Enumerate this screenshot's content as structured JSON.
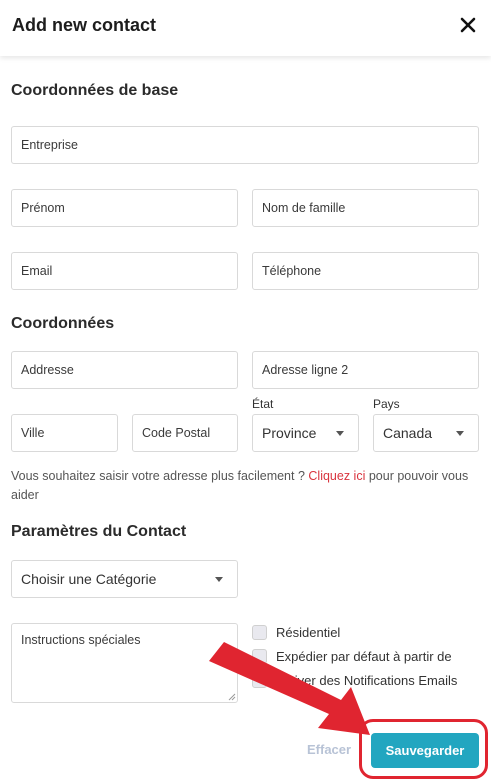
{
  "header": {
    "title": "Add new contact",
    "close_icon": "close-icon"
  },
  "sections": {
    "basic": "Coordonnées de base",
    "address": "Coordonnées",
    "params": "Paramètres du Contact"
  },
  "fields": {
    "company": "Entreprise",
    "first_name": "Prénom",
    "last_name": "Nom de famille",
    "email": "Email",
    "phone": "Téléphone",
    "address1": "Addresse",
    "address2": "Adresse ligne 2",
    "city": "Ville",
    "postal": "Code Postal"
  },
  "state": {
    "label": "État",
    "value": "Province"
  },
  "country": {
    "label": "Pays",
    "value": "Canada"
  },
  "help": {
    "before": "Vous souhaitez saisir votre adresse plus facilement ? ",
    "link": "Cliquez ici",
    "after": " pour pouvoir vous aider"
  },
  "category": {
    "value": "Choisir une Catégorie"
  },
  "instructions": {
    "placeholder": "Instructions spéciales"
  },
  "checks": {
    "residential": "Résidentiel",
    "ship_default": "Expédier par défaut à partir de",
    "notifications": "Activer des Notifications Emails"
  },
  "actions": {
    "clear": "Effacer",
    "save": "Sauvegarder"
  },
  "colors": {
    "accent": "#22a6c0",
    "link": "#d9343e",
    "annotation": "#e02530"
  }
}
